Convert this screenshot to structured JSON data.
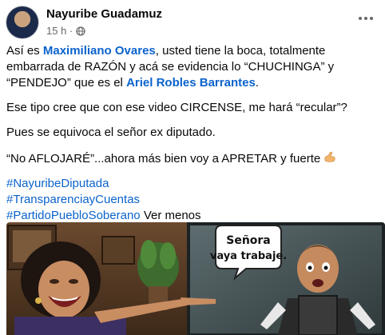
{
  "post": {
    "author": "Nayuribe Guadamuz",
    "time": "15 h ·",
    "privacy_icon": "globe-icon",
    "more_icon": "more-options-icon",
    "paragraph1": {
      "t1": "Así es ",
      "mention1": "Maximiliano Ovares",
      "t2": ", usted tiene la boca, totalmente embarrada de RAZÓN y acá se evidencia lo “CHUCHINGA” y “PENDEJO” que es el ",
      "mention2": "Ariel Robles Barrantes",
      "t3": "."
    },
    "paragraph2": "Ese tipo cree que con ese video CIRCENSE, me hará “recular”?",
    "paragraph3": "Pues se equivoca el señor ex diputado.",
    "paragraph4": "“No AFLOJARÉ”...ahora más bien voy a APRETAR y fuerte",
    "paragraph4_emoji": "flexed-biceps-icon",
    "hashtags": [
      "#NayuribeDiputada",
      "#TransparenciayCuentas",
      "#PartidoPuebloSoberano"
    ],
    "see_less": "Ver menos"
  },
  "image": {
    "speech_bubble": "Señora vaya trabaje."
  },
  "colors": {
    "link": "#0b63cc",
    "secondary_text": "#65676b",
    "text": "#080809"
  }
}
